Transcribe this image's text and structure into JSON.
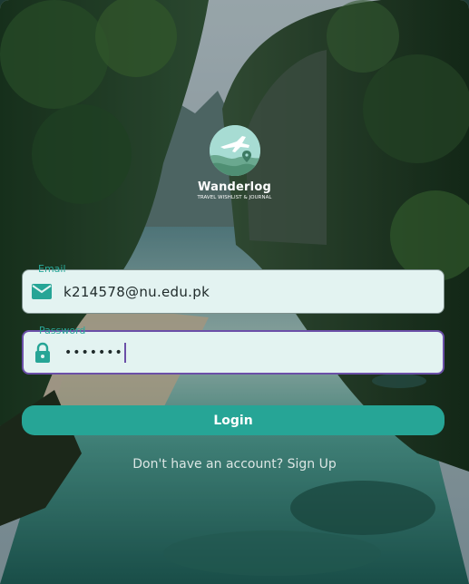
{
  "app": {
    "brand_name": "Wanderlog",
    "tagline": "TRAVEL WISHLIST & JOURNAL",
    "logo_icon": "airplane-map-pin-icon"
  },
  "form": {
    "email": {
      "label": "Email",
      "value": "k214578@nu.edu.pk",
      "icon": "mail-icon"
    },
    "password": {
      "label": "Password",
      "masked_value": "•••••••",
      "icon": "lock-icon"
    },
    "login_label": "Login",
    "signup_prompt": "Don't have an account?",
    "signup_link": "Sign Up"
  },
  "colors": {
    "accent": "#26a596",
    "field_bg": "#e3f3f1",
    "focus_border": "#6b4fa8",
    "label": "#2aa89a"
  }
}
